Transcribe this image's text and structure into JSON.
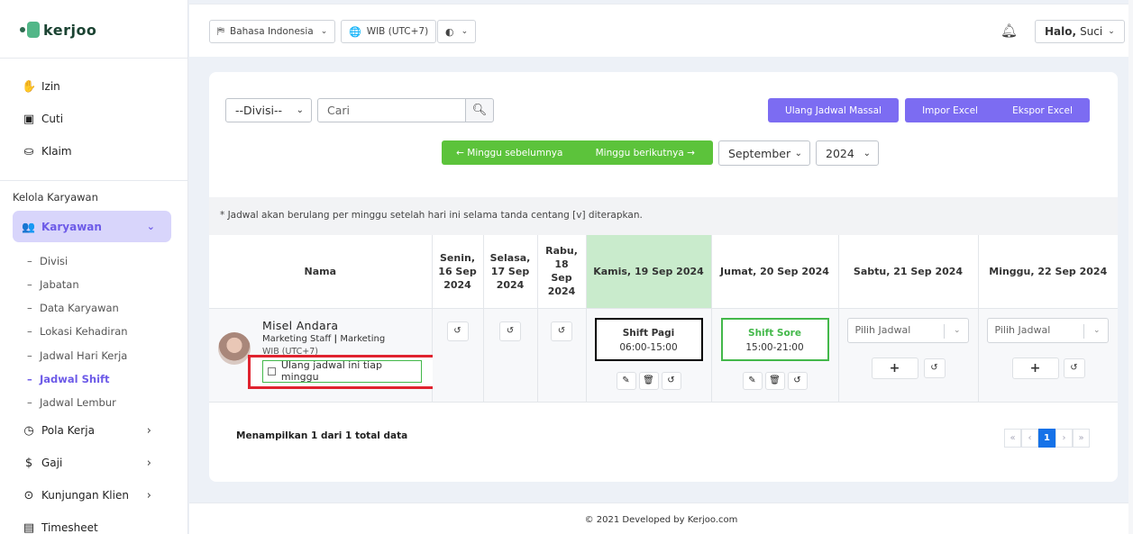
{
  "brand": {
    "name": "kerjoo"
  },
  "sidebar": {
    "top_items": [
      {
        "label": "Izin",
        "icon": "hand-icon"
      },
      {
        "label": "Cuti",
        "icon": "briefcase-icon"
      },
      {
        "label": "Klaim",
        "icon": "hand-holding-icon"
      }
    ],
    "section_label": "Kelola Karyawan",
    "active_group": {
      "label": "Karyawan",
      "icon": "users-icon"
    },
    "sub_items": [
      {
        "label": "Divisi"
      },
      {
        "label": "Jabatan"
      },
      {
        "label": "Data Karyawan"
      },
      {
        "label": "Lokasi Kehadiran"
      },
      {
        "label": "Jadwal Hari Kerja"
      },
      {
        "label": "Jadwal Shift",
        "active": true
      },
      {
        "label": "Jadwal Lembur"
      }
    ],
    "bottom_items": [
      {
        "label": "Pola Kerja",
        "icon": "clock-icon"
      },
      {
        "label": "Gaji",
        "icon": "dollar-icon"
      },
      {
        "label": "Kunjungan Klien",
        "icon": "map-pin-icon"
      },
      {
        "label": "Timesheet",
        "icon": "timesheet-icon"
      }
    ]
  },
  "topbar": {
    "language": "Bahasa Indonesia",
    "timezone": "WIB (UTC+7)",
    "greeting_bold": "Halo,",
    "user_name": "Suci"
  },
  "filters": {
    "division": "--Divisi--",
    "search_placeholder": "Cari",
    "month": "September",
    "year": "2024"
  },
  "actions": {
    "repeat_mass": "Ulang Jadwal Massal",
    "import_excel": "Impor Excel",
    "export_excel": "Ekspor Excel",
    "prev_week": "← Minggu sebelumnya",
    "next_week": "Minggu berikutnya →"
  },
  "note": "* Jadwal akan berulang per minggu setelah hari ini selama tanda centang [v] diterapkan.",
  "table": {
    "name_header": "Nama",
    "days": [
      {
        "line1": "Senin,",
        "line2": "16 Sep",
        "line3": "2024"
      },
      {
        "line1": "Selasa,",
        "line2": "17 Sep",
        "line3": "2024"
      },
      {
        "line1": "Rabu,",
        "line2": "18",
        "line3": "Sep",
        "line4": "2024"
      },
      {
        "label": "Kamis, 19 Sep 2024",
        "today": true
      },
      {
        "label": "Jumat, 20 Sep 2024"
      },
      {
        "label": "Sabtu, 21 Sep 2024"
      },
      {
        "label": "Minggu, 22 Sep 2024"
      }
    ],
    "employee": {
      "name": "Misel Andara",
      "position": "Marketing Staff",
      "division": "Marketing",
      "timezone": "WIB (UTC+7)",
      "repeat_label": "Ulang jadwal ini tiap minggu"
    },
    "shifts": {
      "thu": {
        "name": "Shift Pagi",
        "time": "06:00-15:00"
      },
      "fri": {
        "name": "Shift Sore",
        "time": "15:00-21:00"
      }
    },
    "pick_placeholder": "Pilih Jadwal"
  },
  "summary": "Menampilkan 1 dari 1 total data",
  "pagination": {
    "first": "«",
    "prev": "‹",
    "current": "1",
    "next": "›",
    "last": "»"
  },
  "footer": "© 2021 Developed by Kerjoo.com",
  "colors": {
    "accent": "#7c6cf2",
    "green": "#5cc33b",
    "today_bg": "#c9ebcc",
    "highlight_red": "#e0232f"
  }
}
